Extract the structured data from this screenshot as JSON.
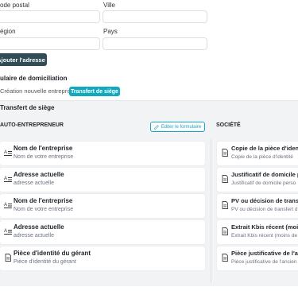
{
  "form": {
    "postal_code_label": "ode postal",
    "city_label": "Ville",
    "region_label": "égion",
    "country_label": "Pays",
    "postal_code_value": "",
    "city_value": "",
    "region_value": "",
    "country_value": "",
    "add_address_button": "Ajouter l'adresse"
  },
  "domiciliation": {
    "title": "ulaire de domiciliation",
    "tab_new": "Création nouvelle entreprise",
    "tab_transfer": "Transfert de siège"
  },
  "panel": {
    "title": "Transfert de siège",
    "auto_title": "AUTO-ENTREPRENEUR",
    "edit_button": "Editer le formulaire",
    "societe_title": "SOCIÉTÉ",
    "auto_cards": [
      {
        "icon": "text-field-icon",
        "title": "Nom de l'entreprise",
        "sub": "Nom de votre entreprise"
      },
      {
        "icon": "text-field-icon",
        "title": "Adresse actuelle",
        "sub": "adresse actuelle"
      },
      {
        "icon": "text-field-icon",
        "title": "Nom de l'entreprise",
        "sub": "Nom de votre entreprise"
      },
      {
        "icon": "text-field-icon",
        "title": "Adresse actuelle",
        "sub": "adresse actuelle"
      },
      {
        "icon": "document-icon",
        "title": "Pièce d'identité du gérant",
        "sub": "Pièce d'identité du gérant"
      }
    ],
    "societe_cards": [
      {
        "icon": "document-icon",
        "title": "Copie de la pièce d'identi",
        "sub": "Copie de la pièce d'identité"
      },
      {
        "icon": "document-icon",
        "title": "Justificatif de domicile p",
        "sub": "Justificatif de domicile perso"
      },
      {
        "icon": "document-icon",
        "title": "PV ou décision de transf",
        "sub": "PV ou décision de transfert d"
      },
      {
        "icon": "document-icon",
        "title": "Extrait Kbis récent (moins",
        "sub": "Extrait Kbis récent (moins de"
      },
      {
        "icon": "document-icon",
        "title": "Pièce justificative de l'an",
        "sub": "Pièce justificative de l'ancien"
      }
    ]
  },
  "colors": {
    "accent": "#12a9bf",
    "dark_button": "#2f4c57",
    "panel_bg": "#f2f3f5"
  }
}
